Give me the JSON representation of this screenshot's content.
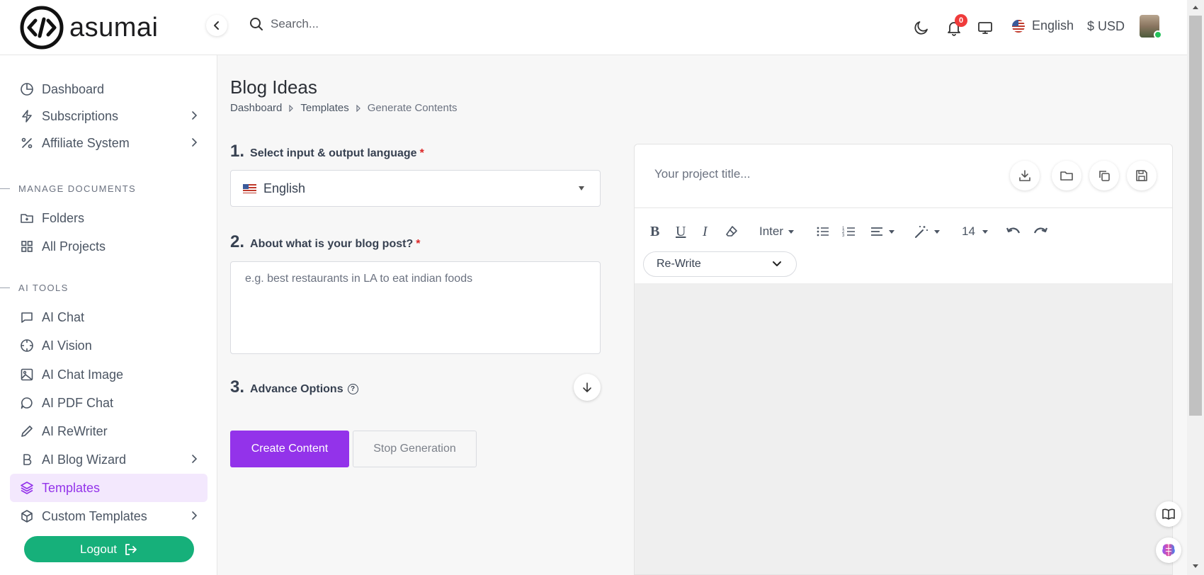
{
  "brand": {
    "name": "asumai"
  },
  "header": {
    "search_placeholder": "Search...",
    "notifications_count": "0",
    "language": "English",
    "currency": "$ USD"
  },
  "sidebar": {
    "top_items": [
      {
        "label": "Dashboard",
        "icon": "pie-chart-icon"
      },
      {
        "label": "Subscriptions",
        "icon": "lightning-icon"
      },
      {
        "label": "Affiliate System",
        "icon": "percent-icon"
      }
    ],
    "section_documents": "MANAGE DOCUMENTS",
    "doc_items": [
      {
        "label": "Folders",
        "icon": "folder-plus-icon"
      },
      {
        "label": "All Projects",
        "icon": "grid-icon"
      }
    ],
    "section_tools": "AI TOOLS",
    "tool_items": [
      {
        "label": "AI Chat",
        "icon": "chat-icon"
      },
      {
        "label": "AI Vision",
        "icon": "crosshair-icon"
      },
      {
        "label": "AI Chat Image",
        "icon": "image-icon"
      },
      {
        "label": "AI PDF Chat",
        "icon": "message-circle-icon"
      },
      {
        "label": "AI ReWriter",
        "icon": "pen-icon"
      },
      {
        "label": "AI Blog Wizard",
        "icon": "bold-b-icon"
      },
      {
        "label": "Templates",
        "icon": "layers-icon"
      },
      {
        "label": "Custom Templates",
        "icon": "package-icon"
      }
    ],
    "logout_label": "Logout"
  },
  "main": {
    "title": "Blog Ideas",
    "breadcrumb": [
      "Dashboard",
      "Templates",
      "Generate Contents"
    ],
    "step1": {
      "num": "1.",
      "label": "Select input & output language",
      "required": "*",
      "value": "English"
    },
    "step2": {
      "num": "2.",
      "label": "About what is your blog post?",
      "required": "*",
      "placeholder": "e.g. best restaurants in LA to eat indian foods"
    },
    "step3": {
      "num": "3.",
      "label": "Advance Options",
      "help": "?"
    },
    "create_label": "Create Content",
    "stop_label": "Stop Generation"
  },
  "editor": {
    "title_placeholder": "Your project title...",
    "font": "Inter",
    "font_size": "14",
    "rewrite_value": "Re-Write"
  },
  "colors": {
    "accent": "#9333ea",
    "active_bg": "#f3e8fd",
    "logout_green": "#16b07a",
    "badge_red": "#ef3b3b"
  }
}
